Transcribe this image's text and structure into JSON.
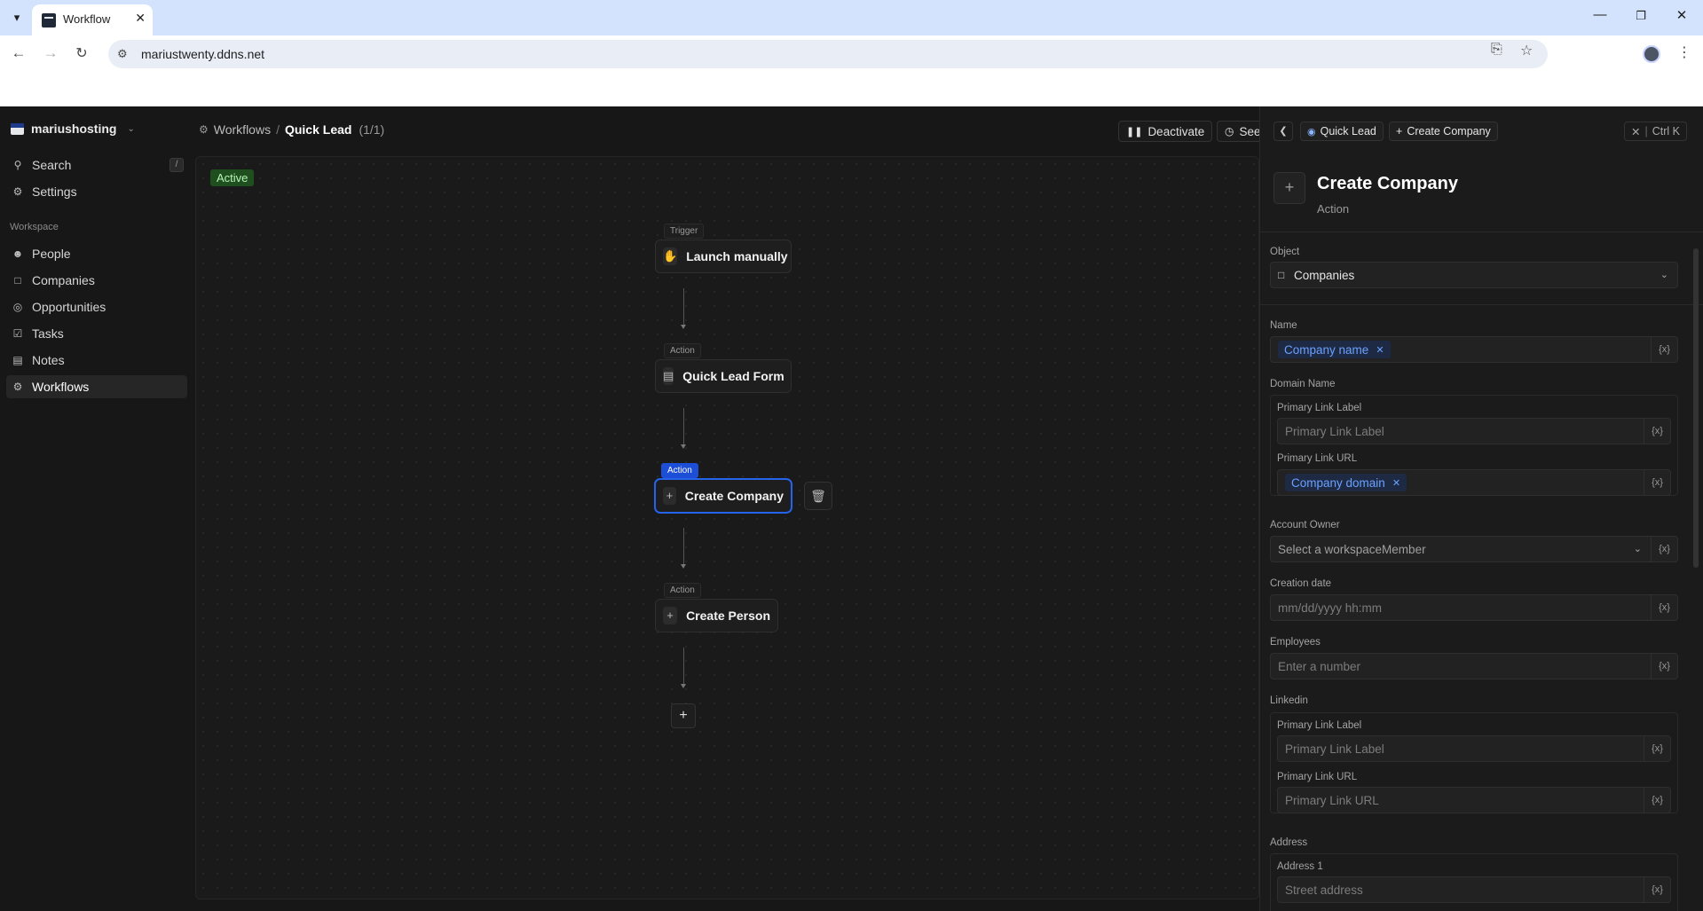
{
  "browser": {
    "tab_title": "Workflow",
    "url": "mariustwenty.ddns.net"
  },
  "sidebar": {
    "workspace_name": "mariushosting",
    "search_label": "Search",
    "search_shortcut": "/",
    "settings_label": "Settings",
    "section_label": "Workspace",
    "items": [
      {
        "label": "People",
        "icon": "person-icon"
      },
      {
        "label": "Companies",
        "icon": "building-icon"
      },
      {
        "label": "Opportunities",
        "icon": "target-icon"
      },
      {
        "label": "Tasks",
        "icon": "checkbox-icon"
      },
      {
        "label": "Notes",
        "icon": "note-icon"
      },
      {
        "label": "Workflows",
        "icon": "workflow-icon",
        "active": true
      }
    ]
  },
  "header": {
    "breadcrumb_root": "Workflows",
    "breadcrumb_sep": "/",
    "breadcrumb_current": "Quick Lead",
    "breadcrumb_count": "(1/1)",
    "deactivate_label": "Deactivate",
    "see_label": "See"
  },
  "canvas": {
    "status_badge": "Active",
    "nodes": [
      {
        "tag": "Trigger",
        "label": "Launch manually"
      },
      {
        "tag": "Action",
        "label": "Quick Lead Form"
      },
      {
        "tag": "Action",
        "label": "Create Company",
        "selected": true
      },
      {
        "tag": "Action",
        "label": "Create Person"
      }
    ],
    "add_label": "+"
  },
  "panel": {
    "chip_workflow": "Quick Lead",
    "chip_step": "Create Company",
    "close_label": "Ctrl K",
    "title": "Create Company",
    "subtitle": "Action",
    "fields": {
      "object_label": "Object",
      "object_value": "Companies",
      "name_label": "Name",
      "name_chip": "Company name",
      "domain_label": "Domain Name",
      "domain_primary_label_label": "Primary Link Label",
      "domain_primary_label_placeholder": "Primary Link Label",
      "domain_primary_url_label": "Primary Link URL",
      "domain_primary_url_chip": "Company domain",
      "owner_label": "Account Owner",
      "owner_placeholder": "Select a workspaceMember",
      "creation_label": "Creation date",
      "creation_placeholder": "mm/dd/yyyy hh:mm",
      "employees_label": "Employees",
      "employees_placeholder": "Enter a number",
      "linkedin_label": "Linkedin",
      "linkedin_primary_label_label": "Primary Link Label",
      "linkedin_primary_label_placeholder": "Primary Link Label",
      "linkedin_primary_url_label": "Primary Link URL",
      "linkedin_primary_url_placeholder": "Primary Link URL",
      "address_label": "Address",
      "address1_label": "Address 1",
      "address1_placeholder": "Street address"
    }
  }
}
